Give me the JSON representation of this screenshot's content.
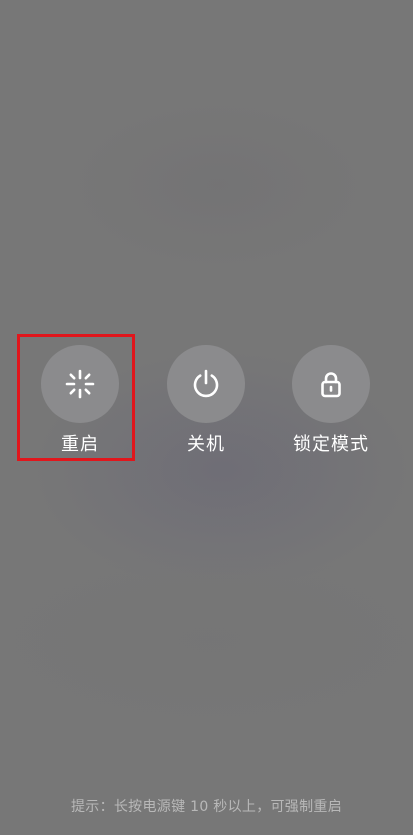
{
  "actions": [
    {
      "label": "重启",
      "icon": "restart-spinner-icon"
    },
    {
      "label": "关机",
      "icon": "power-icon"
    },
    {
      "label": "锁定模式",
      "icon": "lock-icon"
    }
  ],
  "hint": "提示：长按电源键 10 秒以上，可强制重启",
  "colors": {
    "background": "#777777",
    "button_circle": "#8b8b8d",
    "label_text": "#ffffff",
    "hint_text": "#b8b8b8",
    "highlight": "#e1161c"
  }
}
